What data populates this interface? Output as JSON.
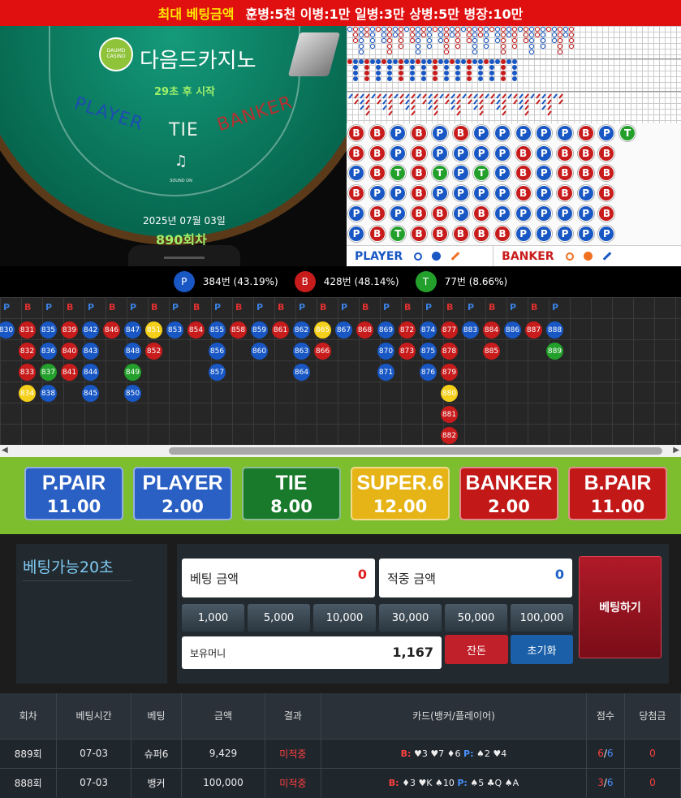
{
  "header": {
    "title": "최대 베팅금액",
    "limits": "훈병:5천 이병:1만 일병:3만 상병:5만 병장:10만"
  },
  "table": {
    "casino_name": "다음드카지노",
    "logo_text": "DAUMD CASINO",
    "countdown": "29초 후 시작",
    "player": "PLAYER",
    "tie": "TIE",
    "banker": "BANKER",
    "sound": "SOUND ON",
    "date": "2025년 07월 03일",
    "round": "890회차"
  },
  "bead_rows": [
    [
      "B",
      "B",
      "P",
      "B",
      "P",
      "B",
      "P",
      "P",
      "P",
      "P",
      "P",
      "B",
      "P",
      "T"
    ],
    [
      "B",
      "B",
      "P",
      "B",
      "P",
      "P",
      "P",
      "P",
      "B",
      "P",
      "B",
      "B",
      "B"
    ],
    [
      "P",
      "B",
      "T",
      "B",
      "T",
      "P",
      "T",
      "P",
      "B",
      "P",
      "B",
      "B",
      "B"
    ],
    [
      "B",
      "P",
      "P",
      "B",
      "P",
      "P",
      "P",
      "P",
      "B",
      "P",
      "B",
      "P",
      "B"
    ],
    [
      "P",
      "B",
      "P",
      "B",
      "B",
      "P",
      "B",
      "P",
      "P",
      "P",
      "P",
      "P",
      "B"
    ],
    [
      "P",
      "B",
      "T",
      "B",
      "B",
      "B",
      "B",
      "B",
      "P",
      "P",
      "P",
      "P",
      "P"
    ]
  ],
  "legend": {
    "player": "PLAYER",
    "banker": "BANKER"
  },
  "stats": [
    {
      "letter": "P",
      "text": "384번 (43.19%)",
      "color": "#1857c4"
    },
    {
      "letter": "B",
      "text": "428번 (48.14%)",
      "color": "#c81c1c"
    },
    {
      "letter": "T",
      "text": "77번 (8.66%)",
      "color": "#23a02b"
    }
  ],
  "road_headers": [
    "P",
    "B",
    "P",
    "B",
    "P",
    "B",
    "P",
    "B",
    "P",
    "B",
    "P",
    "B",
    "P",
    "B",
    "P",
    "B",
    "P",
    "B",
    "P",
    "B",
    "P",
    "B",
    "P",
    "B",
    "P",
    "B",
    "P"
  ],
  "road_cols": [
    [
      [
        "830",
        "P"
      ]
    ],
    [
      [
        "831",
        "B"
      ],
      [
        "832",
        "B"
      ],
      [
        "833",
        "B"
      ],
      [
        "834",
        "Y"
      ]
    ],
    [
      [
        "835",
        "P"
      ],
      [
        "836",
        "P"
      ],
      [
        "837",
        "T"
      ],
      [
        "838",
        "P"
      ]
    ],
    [
      [
        "839",
        "B"
      ],
      [
        "840",
        "B"
      ],
      [
        "841",
        "B"
      ]
    ],
    [
      [
        "842",
        "P"
      ],
      [
        "843",
        "P"
      ],
      [
        "844",
        "P"
      ],
      [
        "845",
        "P"
      ]
    ],
    [
      [
        "846",
        "B"
      ]
    ],
    [
      [
        "847",
        "P"
      ],
      [
        "848",
        "P"
      ],
      [
        "849",
        "T"
      ],
      [
        "850",
        "P"
      ]
    ],
    [
      [
        "851",
        "Y"
      ],
      [
        "852",
        "B"
      ]
    ],
    [
      [
        "853",
        "P"
      ]
    ],
    [
      [
        "854",
        "B"
      ]
    ],
    [
      [
        "855",
        "P"
      ],
      [
        "856",
        "P"
      ],
      [
        "857",
        "P"
      ]
    ],
    [
      [
        "858",
        "B"
      ]
    ],
    [
      [
        "859",
        "P"
      ],
      [
        "860",
        "P"
      ]
    ],
    [
      [
        "861",
        "B"
      ]
    ],
    [
      [
        "862",
        "P"
      ],
      [
        "863",
        "P"
      ],
      [
        "864",
        "P"
      ]
    ],
    [
      [
        "865",
        "Y"
      ],
      [
        "866",
        "B"
      ]
    ],
    [
      [
        "867",
        "P"
      ]
    ],
    [
      [
        "868",
        "B"
      ]
    ],
    [
      [
        "869",
        "P"
      ],
      [
        "870",
        "P"
      ],
      [
        "871",
        "P"
      ]
    ],
    [
      [
        "872",
        "B"
      ],
      [
        "873",
        "B"
      ]
    ],
    [
      [
        "874",
        "P"
      ],
      [
        "875",
        "P"
      ],
      [
        "876",
        "P"
      ]
    ],
    [
      [
        "877",
        "B"
      ],
      [
        "878",
        "B"
      ],
      [
        "879",
        "B"
      ],
      [
        "880",
        "Y"
      ],
      [
        "881",
        "B"
      ],
      [
        "882",
        "B"
      ]
    ],
    [
      [
        "883",
        "P"
      ]
    ],
    [
      [
        "884",
        "B"
      ],
      [
        "885",
        "B"
      ]
    ],
    [
      [
        "886",
        "P"
      ]
    ],
    [
      [
        "887",
        "B"
      ]
    ],
    [
      [
        "888",
        "P"
      ],
      [
        "889",
        "T"
      ]
    ]
  ],
  "bets": [
    {
      "name": "P.PAIR",
      "odds": "11.00",
      "color": "#2a5fc4"
    },
    {
      "name": "PLAYER",
      "odds": "2.00",
      "color": "#2a5fc4"
    },
    {
      "name": "TIE",
      "odds": "8.00",
      "color": "#187a2a"
    },
    {
      "name": "SUPER.6",
      "odds": "12.00",
      "color": "#e6b416"
    },
    {
      "name": "BANKER",
      "odds": "2.00",
      "color": "#c21818"
    },
    {
      "name": "B.PAIR",
      "odds": "11.00",
      "color": "#c21818"
    }
  ],
  "control": {
    "bet_timer": "베팅가능20초",
    "bet_amount_label": "베팅 금액",
    "bet_amount": "0",
    "hit_amount_label": "적중 금액",
    "hit_amount": "0",
    "chips": [
      "1,000",
      "5,000",
      "10,000",
      "30,000",
      "50,000",
      "100,000"
    ],
    "balance_label": "보유머니",
    "balance": "1,167",
    "change_btn": "잔돈",
    "reset_btn": "초기화",
    "place_btn": "베팅하기"
  },
  "history": {
    "headers": [
      "회차",
      "베팅시간",
      "베팅",
      "금액",
      "결과",
      "카드(뱅커/플레이어)",
      "점수",
      "당첨금"
    ],
    "rows": [
      {
        "round": "889회",
        "time": "07-03",
        "bet": "슈퍼6",
        "amount": "9,429",
        "result": "미적중",
        "banker_label": "B:",
        "banker_cards": "♥3 ♥7 ♦6",
        "player_label": "P:",
        "player_cards": "♠2 ♥4",
        "score_b": "6",
        "score_p": "6",
        "win": "0"
      },
      {
        "round": "888회",
        "time": "07-03",
        "bet": "뱅커",
        "amount": "100,000",
        "result": "미적중",
        "banker_label": "B:",
        "banker_cards": "♦3 ♥K ♠10",
        "player_label": "P:",
        "player_cards": "♠5 ♣Q ♠A",
        "score_b": "3",
        "score_p": "6",
        "win": "0"
      }
    ]
  },
  "colors": {
    "player": "#1857c4",
    "banker": "#c81c1c",
    "tie": "#23a02b",
    "super6": "#f4d01a",
    "accent_green": "#7dbe2e"
  }
}
